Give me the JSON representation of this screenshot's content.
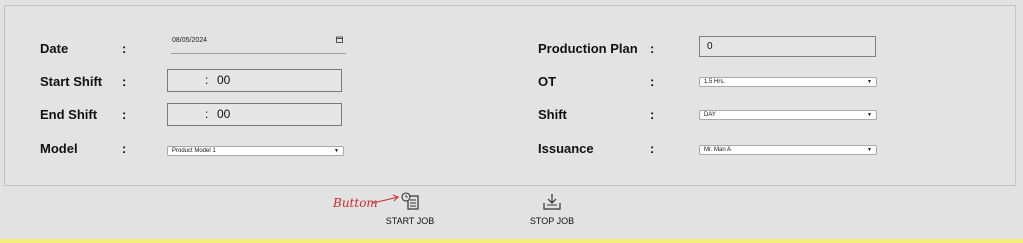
{
  "form": {
    "date_label": "Date",
    "start_shift_label": "Start Shift",
    "end_shift_label": "End Shift",
    "model_label": "Model",
    "production_plan_label": "Production Plan",
    "ot_label": "OT",
    "shift_label": "Shift",
    "issuance_label": "Issuance",
    "colon": ":",
    "date_value": "08/05/2024",
    "start_shift": {
      "sep": ":",
      "minutes": "00"
    },
    "end_shift": {
      "sep": ":",
      "minutes": "00"
    },
    "model_value": "Product Model 1",
    "production_plan_value": "0",
    "ot_value": "1.5 Hrs.",
    "shift_value": "DAY",
    "issuance_value": "Mr. Man A"
  },
  "actions": {
    "start_job_label": "START JOB",
    "stop_job_label": "STOP JOB"
  },
  "annotation": {
    "text": "Buttom"
  },
  "icons": {
    "calendar": "calendar-icon",
    "dropdown": "chevron-down-icon",
    "start_job": "clock-document-icon",
    "stop_job": "download-tray-icon"
  },
  "colors": {
    "background": "#e2e2e2",
    "annotation": "#cc2a2a",
    "bottom_strip": "#f4f07a"
  }
}
